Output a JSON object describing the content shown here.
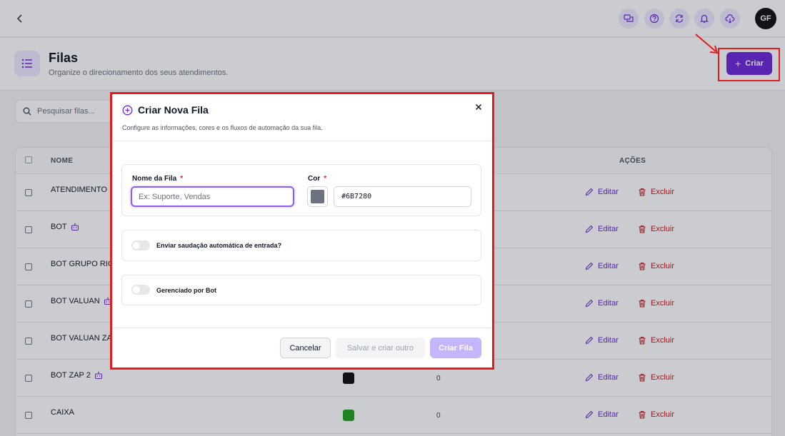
{
  "topbar": {
    "icons": [
      "chat-icon",
      "help-icon",
      "refresh-icon",
      "bell-icon",
      "cloud-download-icon"
    ],
    "avatar_initials": "GF"
  },
  "header": {
    "title": "Filas",
    "subtitle": "Organize o direcionamento dos seus atendimentos.",
    "create_button": "Criar"
  },
  "search": {
    "placeholder": "Pesquisar filas..."
  },
  "table": {
    "headers": {
      "name": "NOME",
      "actions": "AÇÕES"
    },
    "edit_label": "Editar",
    "delete_label": "Excluir",
    "rows": [
      {
        "name": "ATENDIMENTO",
        "bot": false,
        "color": "",
        "count": ""
      },
      {
        "name": "BOT",
        "bot": true,
        "color": "",
        "count": ""
      },
      {
        "name": "BOT GRUPO RIO",
        "bot": false,
        "color": "",
        "count": ""
      },
      {
        "name": "BOT VALUAN",
        "bot": true,
        "color": "",
        "count": ""
      },
      {
        "name": "BOT VALUAN ZA",
        "bot": false,
        "color": "",
        "count": ""
      },
      {
        "name": "BOT ZAP 2",
        "bot": true,
        "color": "#111111",
        "count": "0"
      },
      {
        "name": "CAIXA",
        "bot": false,
        "color": "#22a322",
        "count": "0"
      }
    ]
  },
  "modal": {
    "title": "Criar Nova Fila",
    "description": "Configure as informações, cores e os fluxos de automação da sua fila.",
    "name_label": "Nome da Fila",
    "name_placeholder": "Ex: Suporte, Vendas",
    "color_label": "Cor",
    "color_value": "#6B7280",
    "required_mark": "*",
    "greeting_toggle_label": "Enviar saudação automática de entrada?",
    "bot_toggle_label": "Gerenciado por Bot",
    "cancel_button": "Cancelar",
    "save_and_new_button": "Salvar e criar outro",
    "create_button": "Criar Fila"
  },
  "colors": {
    "accent": "#6D28D9",
    "danger": "#B91C1C",
    "highlight": "#E11D1D"
  }
}
